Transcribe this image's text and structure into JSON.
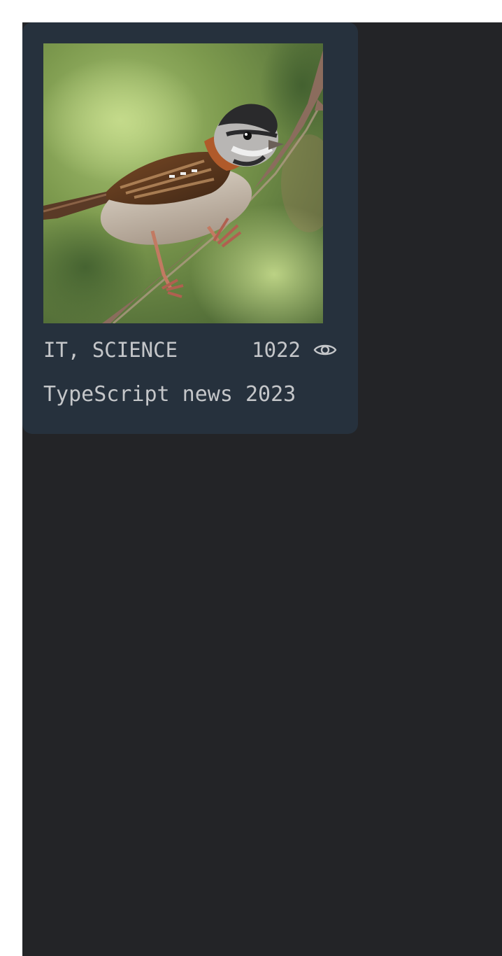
{
  "article_card": {
    "image_alt": "Rufous-collared sparrow perched on a branch",
    "types": "IT, SCIENCE",
    "views": "1022",
    "title": "TypeScript news 2023"
  },
  "icons": {
    "views": "eye-icon"
  },
  "colors": {
    "page_background": "#ffffff",
    "app_background": "#232427",
    "card_background": "#26313d",
    "text": "#c4c6c9"
  }
}
